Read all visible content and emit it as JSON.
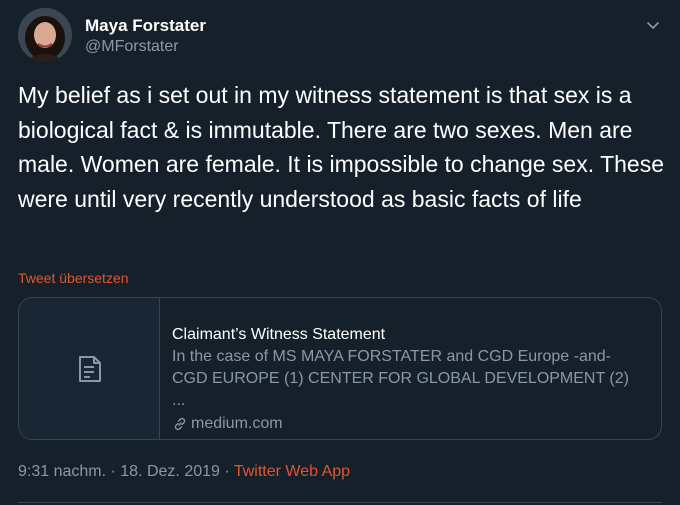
{
  "author": {
    "name": "Maya Forstater",
    "handle": "@MForstater"
  },
  "tweet": {
    "text": "My belief as i set out in my witness statement is that sex is a biological fact & is immutable. There are two sexes. Men are male. Women are female. It is impossible to change sex. These were until very recently understood as basic facts of life",
    "translate_label": "Tweet übersetzen"
  },
  "card": {
    "title": "Claimant’s Witness Statement",
    "description": "In the case of MS MAYA FORSTATER and CGD Europe -and- CGD EUROPE (1) CENTER FOR GLOBAL DEVELOPMENT (2) ...",
    "domain": "medium.com",
    "thumbnail_icon": "document-icon",
    "link_icon": "link-icon"
  },
  "meta": {
    "time": "9:31 nachm.",
    "separator": " · ",
    "date": "18. Dez. 2019",
    "source": "Twitter Web App"
  },
  "colors": {
    "background": "#15202b",
    "secondary_text": "#8899a6",
    "accent": "#e0572e",
    "border": "#38444d"
  },
  "icons": {
    "menu": "chevron-down-icon"
  }
}
